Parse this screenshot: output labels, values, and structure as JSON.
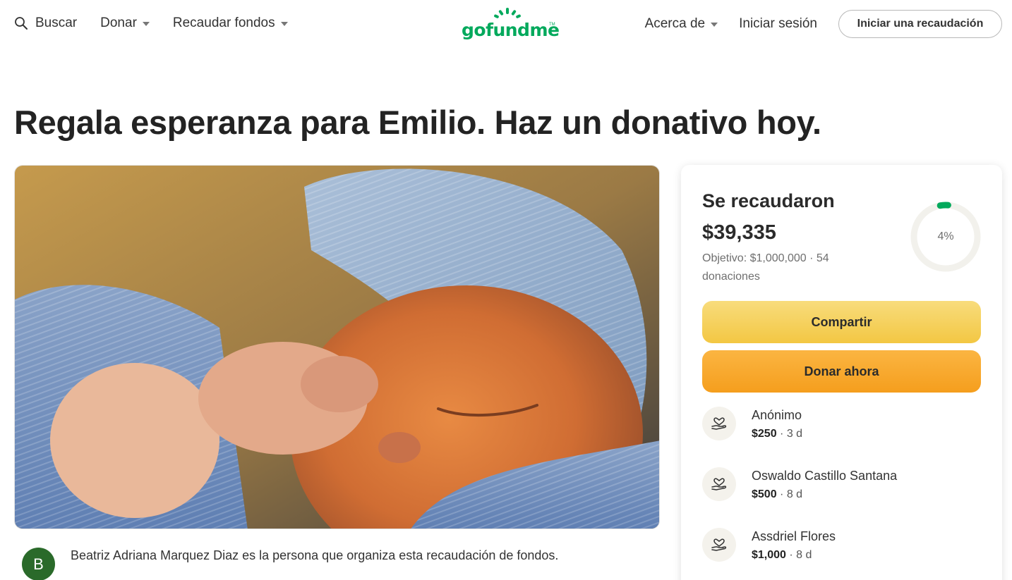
{
  "header": {
    "search_label": "Buscar",
    "donate_label": "Donar",
    "fundraise_label": "Recaudar fondos",
    "logo_text": "gofundme",
    "logo_tm": "TM",
    "about_label": "Acerca de",
    "login_label": "Iniciar sesión",
    "start_button_label": "Iniciar una recaudación"
  },
  "page": {
    "title": "Regala esperanza para Emilio. Haz un donativo hoy."
  },
  "organizer": {
    "avatar_initial": "B",
    "text": "Beatriz Adriana Marquez Diaz es la persona que organiza esta recaudación de fondos."
  },
  "card": {
    "raised_label": "Se recaudaron",
    "raised_amount": "$39,335",
    "goal_text": "Objetivo: $1,000,000 · 54 donaciones",
    "progress_label": "4%",
    "progress_fraction": 0.04,
    "share_label": "Compartir",
    "donate_label": "Donar ahora"
  },
  "donations": [
    {
      "name": "Anónimo",
      "amount": "$250",
      "time": "· 3 d"
    },
    {
      "name": "Oswaldo Castillo Santana",
      "amount": "$500",
      "time": "· 8 d"
    },
    {
      "name": "Assdriel Flores",
      "amount": "$1,000",
      "time": "· 8 d"
    }
  ],
  "colors": {
    "brand_green": "#02a95c",
    "share_yellow": "#f3c743",
    "donate_orange": "#f59e1d"
  },
  "icons": {
    "search": "search-icon",
    "caret": "chevron-down-icon",
    "donor": "heart-hand-icon"
  }
}
